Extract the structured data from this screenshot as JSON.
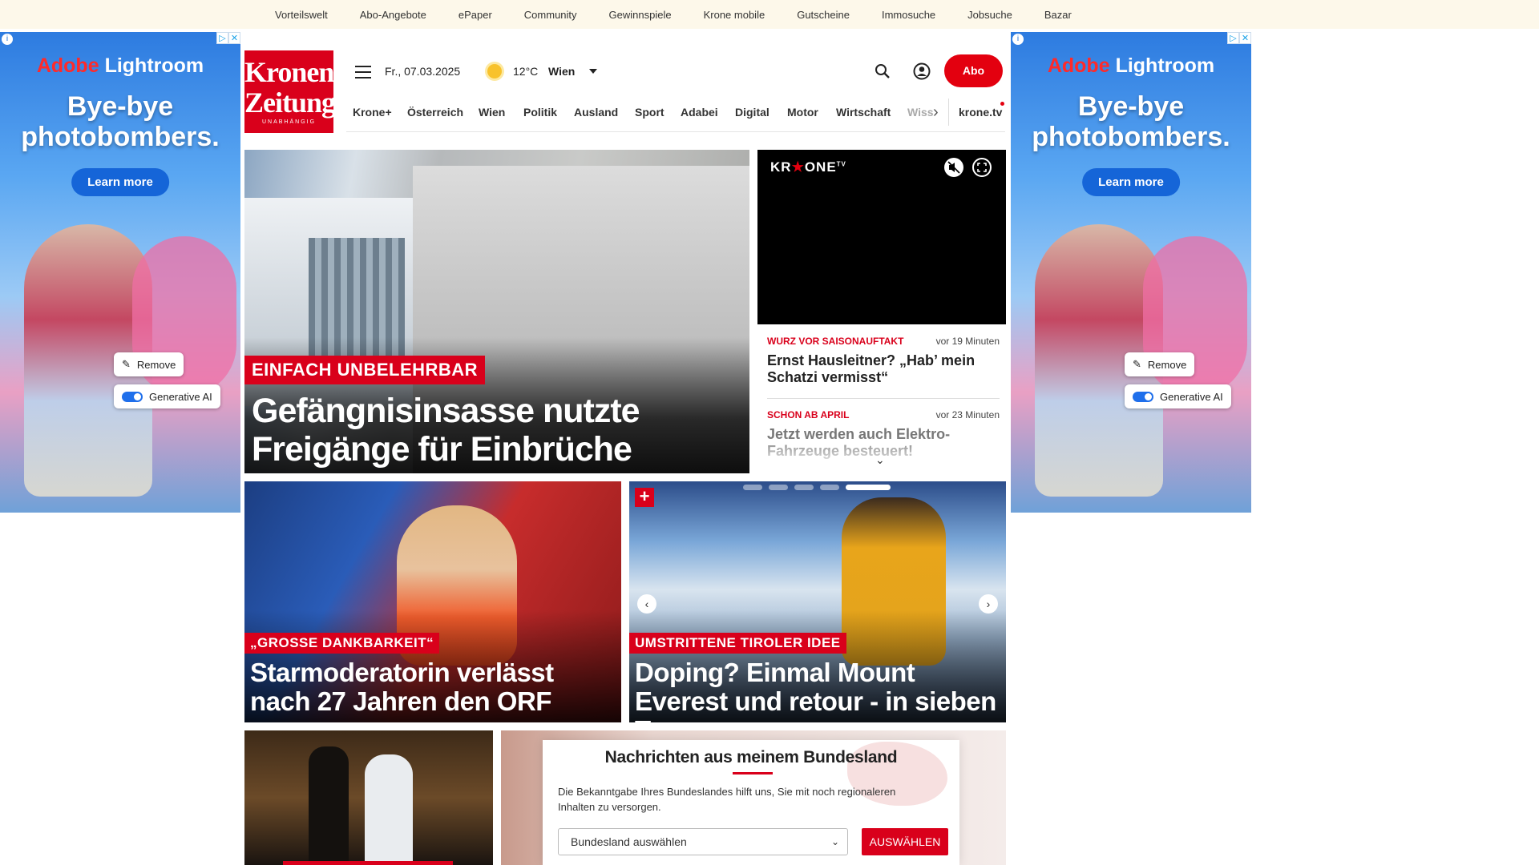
{
  "topbar": {
    "links": [
      "Vorteilswelt",
      "Abo-Angebote",
      "ePaper",
      "Community",
      "Gewinnspiele",
      "Krone mobile",
      "Gutscheine",
      "Immosuche",
      "Jobsuche",
      "Bazar"
    ]
  },
  "ad": {
    "brand_adobe": "Adobe",
    "brand_product": "Lightroom",
    "headline": "Bye-bye photobombers.",
    "cta": "Learn more",
    "remove": "Remove",
    "generative": "Generative AI"
  },
  "header": {
    "logo_line1": "Kronen",
    "logo_line2": "Zeitung",
    "logo_tagline": "UNABHÄNGIG",
    "date": "Fr., 07.03.2025",
    "temperature": "12°C",
    "city": "Wien",
    "abo_label": "Abo"
  },
  "nav": {
    "items": [
      "Krone+",
      "Österreich",
      "Wien",
      "Politik",
      "Ausland",
      "Sport",
      "Adabei",
      "Digital",
      "Motor",
      "Wirtschaft"
    ],
    "faded": "Wiss",
    "tv": "krone.tv"
  },
  "hero": {
    "kicker": "EINFACH UNBELEHRBAR",
    "title": "Gefängnisinsasse nutzte Freigänge für Einbrüche"
  },
  "video": {
    "brand_left": "KR",
    "brand_star": "★",
    "brand_right": "ONE",
    "brand_tv": "TV"
  },
  "ticker": [
    {
      "kicker": "WURZ VOR SAISONAUFTAKT",
      "time": "vor 19 Minuten",
      "headline": "Ernst Hausleitner? „Hab’ mein Schatzi vermisst“"
    },
    {
      "kicker": "SCHON AB APRIL",
      "time": "vor 23 Minuten",
      "headline": "Jetzt werden auch Elektro-Fahrzeuge besteuert!"
    }
  ],
  "cards": [
    {
      "kicker": "„GROSSE DANKBARKEIT“",
      "title": "Starmoderatorin verlässt nach 27 Jahren den ORF"
    },
    {
      "kicker": "UMSTRITTENE TIROLER IDEE",
      "title": "Doping? Einmal Mount Everest und retour - in sieben Tagen"
    }
  ],
  "modal": {
    "title": "Nachrichten aus meinem Bundesland",
    "text": "Die Bekanntgabe Ihres Bundeslandes hilft uns, Sie mit noch regionaleren Inhalten zu versorgen.",
    "select_value": "Bundesland auswählen",
    "button": "AUSWÄHLEN"
  },
  "colors": {
    "brand_red": "#d9001b",
    "topbar_bg": "#fdf8ea"
  },
  "icons": {
    "menu": "hamburger-icon",
    "weather": "sun-icon",
    "search": "search-icon",
    "account": "user-icon",
    "carousel_prev": "chevron-left-icon",
    "carousel_next": "chevron-right-icon"
  }
}
